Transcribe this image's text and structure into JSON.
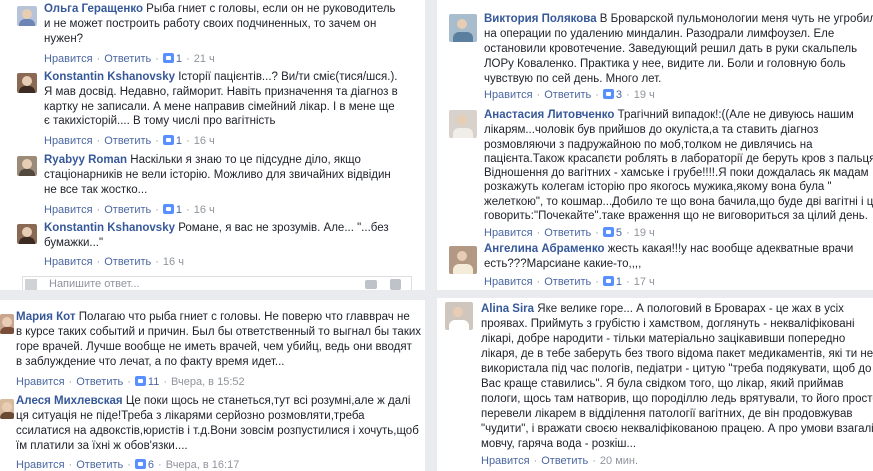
{
  "left": {
    "comments": [
      {
        "name": "Ольга Геращенко",
        "lines": [
          " Рыба гниет с головы, если он не руководитель",
          "и не может построить работу своих подчиненных, то зачем он",
          "нужен?"
        ],
        "reply": "Нравится",
        "answer": "Ответить",
        "likes": "1",
        "time": "21 ч"
      },
      {
        "name": "Konstantin Kshanovsky",
        "lines": [
          " Історії пацієнтів...? Ви/ти смiє(тися/шся.).",
          "Я мав досвід. Недавно, гайморит. Навіть призначення та діагноз в",
          "картку не записали. А мене направив сімейний лікар. І в мене ще",
          "є такихісторій.... В тому числі про вагітність"
        ],
        "reply": "Нравится",
        "answer": "Ответить",
        "likes": "1",
        "time": "16 ч"
      },
      {
        "name": "Ryabyy Roman",
        "lines": [
          " Наскiльки я знаю то це пiдсудне дiло, якщо",
          "стацiонарникiв не вели iсторiю. Можливо для звичайних вiдвiдин",
          "не все так жостко..."
        ],
        "reply": "Нравится",
        "answer": "Ответить",
        "likes": "1",
        "time": "16 ч"
      },
      {
        "name": "Konstantin Kshanovsky",
        "lines": [
          " Романе, я вас не зрозумів. Але... \"...без",
          "бумажки...\""
        ],
        "reply": "Нравится",
        "answer": "Ответить",
        "likes": "",
        "time": "16 ч"
      }
    ],
    "reply_placeholder": "Напишите ответ...",
    "bottom": [
      {
        "name": "Мария Кот",
        "lines": [
          " Полагаю что рыба гниет с головы. Не поверю что главврач не",
          "в курсе таких событий и причин. Был бы ответственный то выгнал бы таких",
          "горе врачей. Лучше вообще не иметь врачей, чем убийц, ведь они вводят",
          "в заблуждение что лечат, а по факту время идет..."
        ],
        "reply": "Нравится",
        "answer": "Ответить",
        "likes": "11",
        "time": "Вчера, в 15:52"
      },
      {
        "name": "Алеся Михлевская",
        "lines": [
          " Це поки щось не станеться,тут всі розумні,але ж далі",
          "ця ситуація не піде!Треба з лікарями серйозно розмовляти,треба",
          "ссилатися на адвокстів,юристів і т.д.Вони зовсім розпустилися і хочуть,щоб",
          "їм платили за їхні ж обов'язки...."
        ],
        "reply": "Нравится",
        "answer": "Ответить",
        "likes": "6",
        "time": "Вчера, в 16:17"
      }
    ]
  },
  "right": {
    "comments": [
      {
        "name": "Виктория Полякова",
        "lines": [
          " В Броварской пульмонологии меня чуть не угробили",
          "на операции по удалению миндалин. Разодрали лимфоузел. Еле",
          "остановили кровотечение. Заведующий решил дать в руки скальпель",
          "ЛОРу Коваленко. Практика у нее, видите ли. Боли и головную боль",
          "чувствую по сей день. Много лет."
        ],
        "reply": "Нравится",
        "answer": "Ответить",
        "likes": "3",
        "time": "19 ч"
      },
      {
        "name": "Анастасия Литовченко",
        "lines": [
          " Трагічний випадок!:((Але не дивуюсь нашим",
          "лікарям...чоловік був прийшов до окуліста,а та ставить діагноз",
          "розмовляючи з падружайною по моб,толком не дивлячись на",
          "пацієнта.Також красапєти роблять в лабораторії де беруть кров з пальця.",
          "Відношення до вагітних - хамське і грубе!!!!.Я поки дождалась як мадам",
          "розкажуть колегам історію про якогось мужика,якому вона була \"",
          "желеткою\", то кошмар...Добило те що вона бачила,що буде дві вагітні і це",
          "говорить:\"Почекайте\".таке враження що не виговориться за цілий день."
        ],
        "reply": "Нравится",
        "answer": "Ответить",
        "likes": "5",
        "time": "19 ч"
      },
      {
        "name": "Ангелина Абраменко",
        "lines": [
          " жесть какая!!!у нас вообще адекватные врачи",
          "есть???Марсиане какие-то,,,,"
        ],
        "reply": "Нравится",
        "answer": "Ответить",
        "likes": "1",
        "time": "17 ч"
      },
      {
        "name": "Alina Sira",
        "lines": [
          " Яке велике горе... А пологовий в Броварах - це жах в усіх",
          "проявах. Приймуть з грубістю і хамством, доглянуть - некваліфіковані",
          "лікарі, добре народити - тільки матеріально зацікавивши попереднo",
          "лікаря, де в тебе заберуть без твого відома пакет медикаментів, які ти не",
          "використала під час пологів, педіатри - цитую \"треба подякувати, щоб до",
          "Вас краще ставились\". Я була свідком того, що лікар, який приймав",
          "пологи, щось там натворив, що породіллю ледь врятували, то його просто",
          "перевели лікарем в відділення патології вагітних, де він продовжував",
          "\"чудити\", і вражати своєю некваліфікованою працею. А про умови взагалі",
          "мовчу, гаряча вода - розкiш..."
        ],
        "reply": "Нравится",
        "answer": "Ответить",
        "likes": "",
        "time": "20 мин."
      }
    ]
  },
  "colors": {
    "link": "#365899",
    "meta": "#90949c",
    "like": "#5890ff"
  }
}
